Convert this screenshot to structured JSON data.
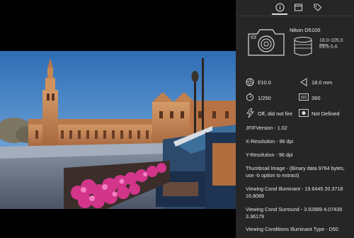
{
  "tabs": [
    {
      "name": "info",
      "icon": "info-icon",
      "selected": true
    },
    {
      "name": "metadata",
      "icon": "card-icon",
      "selected": false
    },
    {
      "name": "tags",
      "icon": "tag-icon",
      "selected": false
    }
  ],
  "camera": {
    "model": "Nikon D5100",
    "lens_line1": "18.0-105.0 mm",
    "lens_line2": "f/3.5-5.6"
  },
  "exposure": {
    "aperture": "f/10.0",
    "focal_length": "18.0 mm",
    "shutter": "1/250",
    "iso": "360",
    "flash": "Off, did not fire",
    "metering": "Not Defined"
  },
  "details": [
    "JFIFVersion - 1.02",
    "X-Resolution - 96 dpi",
    "Y-Resolution - 96 dpi",
    "Thumbnail Image - (Binary data 9764 bytes, use -b option to extract)",
    "Viewing Cond Illuminant - 19.6445 20.3718 16.8089",
    "Viewing Cond Surround - 3.92889 4.07439 3.36179",
    "Viewing Conditions Illuminant Type - D50"
  ],
  "colors": {
    "panel_bg": "#262626",
    "viewer_bg": "#000000",
    "text": "#e8e8e8"
  }
}
